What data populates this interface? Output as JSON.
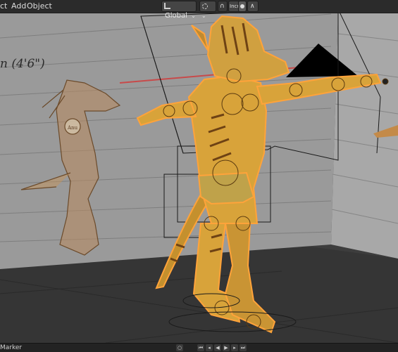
{
  "header": {
    "menu": [
      "ct",
      "Add",
      "Object"
    ],
    "transform_orientation": "Global",
    "snap_label": "Incr"
  },
  "viewport": {
    "reference_height_label": "n  (4'6\")",
    "badge_text": "Anu"
  },
  "timeline": {
    "marker_label": "Marker",
    "playback_icons": [
      "jump-start-icon",
      "step-back-icon",
      "play-reverse-icon",
      "play-icon",
      "step-forward-icon",
      "jump-end-icon"
    ]
  },
  "colors": {
    "header_bg": "#2b2b2b",
    "viewport_bg": "#3d3d3d",
    "wall": "#9a9a9a",
    "floor": "#353535",
    "character_fill": "#d8a33a",
    "selection_outline": "#ffa33a"
  }
}
